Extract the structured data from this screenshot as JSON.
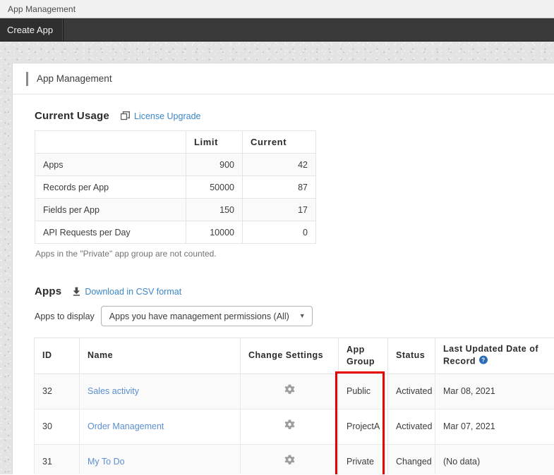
{
  "window": {
    "title": "App Management"
  },
  "app_bar": {
    "create_app_label": "Create App"
  },
  "panel": {
    "header_title": "App Management"
  },
  "current_usage": {
    "heading": "Current Usage",
    "license_link": "License Upgrade",
    "license_icon": "external-link-icon",
    "columns": [
      "",
      "Limit",
      "Current"
    ],
    "rows": [
      {
        "label": "Apps",
        "limit": "900",
        "current": "42"
      },
      {
        "label": "Records per App",
        "limit": "50000",
        "current": "87"
      },
      {
        "label": "Fields per App",
        "limit": "150",
        "current": "17"
      },
      {
        "label": "API Requests per Day",
        "limit": "10000",
        "current": "0"
      }
    ],
    "note": "Apps in the \"Private\" app group are not counted."
  },
  "apps_section": {
    "heading": "Apps",
    "download_link": "Download in CSV format",
    "download_icon": "download-icon",
    "filter_label": "Apps to display",
    "filter_value": "Apps you have management permissions (All)",
    "filter_caret": "▼",
    "columns": {
      "id": "ID",
      "name": "Name",
      "change_settings": "Change Settings",
      "app_group": "App\nGroup",
      "app_group_line1": "App",
      "app_group_line2": "Group",
      "status": "Status",
      "last_updated_line1": "Last Updated Date of",
      "last_updated_line2": "Record",
      "help_icon": "help-icon"
    },
    "rows": [
      {
        "id": "32",
        "name": "Sales activity",
        "settings_icon": "gear-icon",
        "app_group": "Public",
        "status": "Activated",
        "last_updated": "Mar 08, 2021"
      },
      {
        "id": "30",
        "name": "Order Management",
        "settings_icon": "gear-icon",
        "app_group": "ProjectA",
        "status": "Activated",
        "last_updated": "Mar 07, 2021"
      },
      {
        "id": "31",
        "name": "My To Do",
        "settings_icon": "gear-icon",
        "app_group": "Private",
        "status": "Changed",
        "last_updated": "(No data)"
      }
    ]
  },
  "annotation": {
    "highlight_color": "#e60000",
    "highlight_target": "app-group-column"
  }
}
